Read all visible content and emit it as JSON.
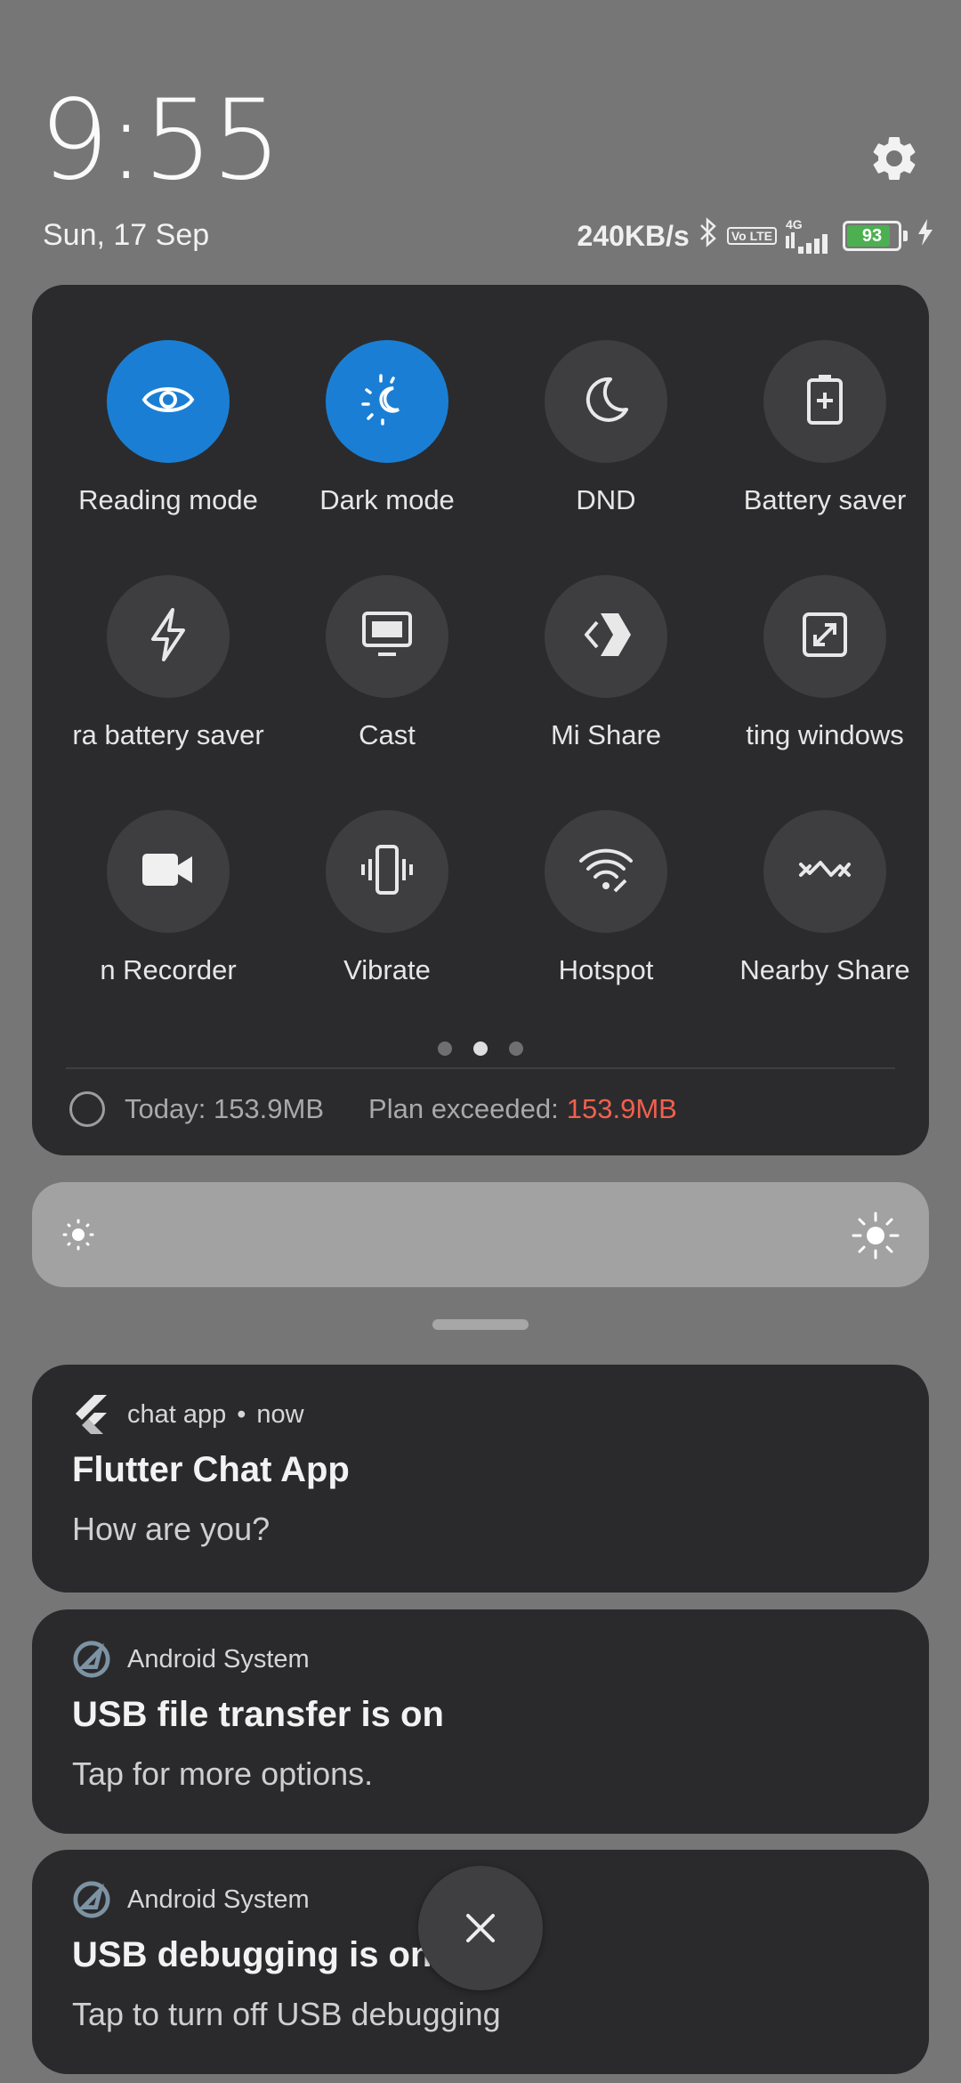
{
  "header": {
    "time": "9:55",
    "date": "Sun, 17 Sep",
    "settings_icon": "gear-icon"
  },
  "status_bar": {
    "speed": "240KB/s",
    "volte": "Vo LTE",
    "network": "4G",
    "battery_level": "93",
    "battery_fraction": 0.93,
    "icons": [
      "bluetooth-icon",
      "volte-icon",
      "signal-icon",
      "battery-icon",
      "charging-icon"
    ]
  },
  "quick_settings": {
    "tiles": [
      {
        "label": "Reading mode",
        "icon": "eye-icon",
        "active": true
      },
      {
        "label": "Dark mode",
        "icon": "sun-moon-icon",
        "active": true
      },
      {
        "label": "DND",
        "icon": "moon-icon",
        "active": false
      },
      {
        "label": "Battery saver",
        "icon": "battery-plus-icon",
        "active": false
      },
      {
        "label": "ra battery saver",
        "icon": "lightning-icon",
        "active": false
      },
      {
        "label": "Cast",
        "icon": "monitor-icon",
        "active": false
      },
      {
        "label": "Mi Share",
        "icon": "mi-share-icon",
        "active": false
      },
      {
        "label": "ting windows",
        "icon": "floating-window-icon",
        "active": false
      },
      {
        "label": "n Recorder",
        "icon": "video-camera-icon",
        "active": false
      },
      {
        "label": "Vibrate",
        "icon": "vibrate-icon",
        "active": false
      },
      {
        "label": "Hotspot",
        "icon": "hotspot-icon",
        "active": false
      },
      {
        "label": "Nearby Share",
        "icon": "nearby-share-icon",
        "active": false
      }
    ],
    "pages": 3,
    "current_page": 2,
    "data_usage": {
      "today": "Today: 153.9MB",
      "plan_label": "Plan exceeded:",
      "plan_value": "153.9MB"
    }
  },
  "brightness": {
    "low_icon": "sun-small-icon",
    "high_icon": "sun-large-icon"
  },
  "notifications": [
    {
      "app": "chat app",
      "separator": "•",
      "time": "now",
      "title": "Flutter Chat App",
      "text": "How are you?",
      "icon": "flutter-icon"
    },
    {
      "app": "Android System",
      "title": "USB file transfer is on",
      "text": "Tap for more options.",
      "icon": "android-system-icon"
    },
    {
      "app": "Android System",
      "title": "USB debugging is on",
      "text": "Tap to turn off USB debugging",
      "icon": "android-system-icon"
    }
  ],
  "colors": {
    "accent_blue": "#1a7fd4",
    "warning_red": "#f2604d",
    "panel": "#2b2b2d",
    "background": "#767676"
  }
}
